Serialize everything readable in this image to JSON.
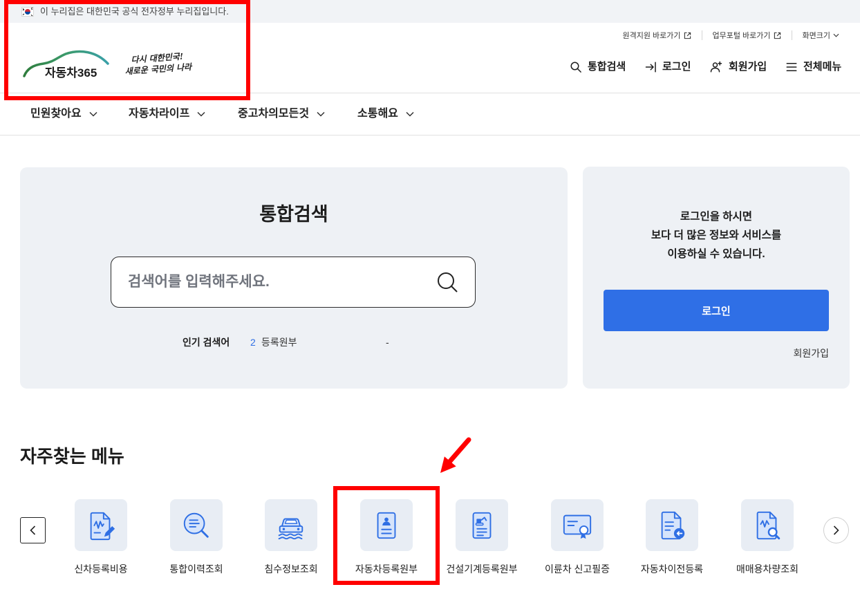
{
  "gov_banner": {
    "flag_icon": "korea-flag-icon",
    "text": "이 누리집은 대한민국 공식 전자정부 누리집입니다."
  },
  "utility": {
    "remote_support": "원격지원 바로가기",
    "work_portal": "업무포털 바로가기",
    "screen_size": "화면크기",
    "link_icon": "external-link-icon",
    "dropdown_icon": "chevron-down-icon"
  },
  "logo": {
    "brand": "자동차365",
    "slogan": [
      "다시 대한민국!",
      "새로운 국민의 나라"
    ]
  },
  "header_nav": [
    {
      "label": "통합검색",
      "icon": "search-icon"
    },
    {
      "label": "로그인",
      "icon": "login-icon"
    },
    {
      "label": "회원가입",
      "icon": "user-plus-icon"
    },
    {
      "label": "전체메뉴",
      "icon": "menu-icon"
    }
  ],
  "main_nav": [
    {
      "label": "민원찾아요"
    },
    {
      "label": "자동차라이프"
    },
    {
      "label": "중고차의모든것"
    },
    {
      "label": "소통해요"
    }
  ],
  "search_panel": {
    "title": "통합검색",
    "placeholder": "검색어를 입력해주세요.",
    "popular_label": "인기 검색어",
    "popular_rank": "2",
    "popular_keyword": "등록원부",
    "popular_trailing": "-"
  },
  "login_panel": {
    "message": [
      "로그인을 하시면",
      "보다 더 많은 정보와 서비스를",
      "이용하실 수 있습니다."
    ],
    "login_button": "로그인",
    "signup_link": "회원가입"
  },
  "frequent_menu": {
    "title": "자주찾는 메뉴",
    "prev_icon": "chevron-left-icon",
    "next_icon": "chevron-right-icon",
    "items": [
      {
        "label": "신차등록비용",
        "icon": "document-pen-icon"
      },
      {
        "label": "통합이력조회",
        "icon": "history-search-icon"
      },
      {
        "label": "침수정보조회",
        "icon": "flooded-car-icon"
      },
      {
        "label": "자동차등록원부",
        "icon": "registration-document-icon"
      },
      {
        "label": "건설기계등록원부",
        "icon": "construction-document-icon"
      },
      {
        "label": "이륜차 신고필증",
        "icon": "certificate-icon"
      },
      {
        "label": "자동차이전등록",
        "icon": "transfer-document-icon"
      },
      {
        "label": "매매용차량조회",
        "icon": "document-search-icon"
      }
    ]
  },
  "colors": {
    "accent": "#2f6fe6",
    "panel_bg": "#eef1f5",
    "tile_bg": "#e8edf4",
    "annotation": "#ff0000"
  }
}
